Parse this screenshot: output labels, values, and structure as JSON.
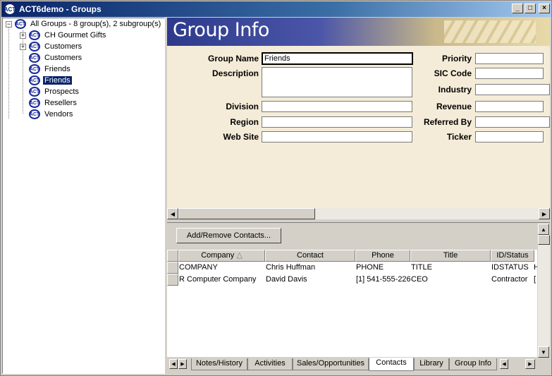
{
  "window": {
    "title": "ACT6demo - Groups",
    "icon": "act-logo-icon"
  },
  "tree": {
    "root": "All Groups - 8 group(s), 2 subgroup(s)",
    "items": [
      {
        "label": "CH Gourmet Gifts",
        "expandable": true
      },
      {
        "label": "Customers",
        "expandable": true
      },
      {
        "label": "Customers",
        "expandable": false
      },
      {
        "label": "Friends",
        "expandable": false
      },
      {
        "label": "Friends",
        "expandable": false,
        "selected": true
      },
      {
        "label": "Prospects",
        "expandable": false
      },
      {
        "label": "Resellers",
        "expandable": false
      },
      {
        "label": "Vendors",
        "expandable": false
      }
    ],
    "expander": "+",
    "root_expander": "−"
  },
  "banner": {
    "title": "Group Info"
  },
  "form": {
    "group_name_label": "Group Name",
    "group_name": "Friends",
    "description_label": "Description",
    "description": "",
    "division_label": "Division",
    "division": "",
    "region_label": "Region",
    "region": "",
    "website_label": "Web Site",
    "website": "",
    "priority_label": "Priority",
    "priority": "",
    "sic_label": "SIC Code",
    "sic": "",
    "industry_label": "Industry",
    "industry": "",
    "revenue_label": "Revenue",
    "revenue": "",
    "referred_label": "Referred By",
    "referred": "",
    "ticker_label": "Ticker",
    "ticker": ""
  },
  "contacts": {
    "add_remove_label": "Add/Remove Contacts...",
    "columns": [
      "Company",
      "Contact",
      "Phone",
      "Title",
      "ID/Status"
    ],
    "sort_indicator": "△",
    "rows": [
      {
        "company": "COMPANY",
        "contact": "Chris Huffman",
        "phone": "PHONE",
        "title": "TITLE",
        "status": "IDSTATUS",
        "extra": "H"
      },
      {
        "company": "R Computer Company",
        "contact": "David Davis",
        "phone": "[1] 541-555-226",
        "title": "CEO",
        "status": "Contractor",
        "extra": "["
      }
    ]
  },
  "tabs": [
    "Notes/History",
    "Activities",
    "Sales/Opportunities",
    "Contacts",
    "Library",
    "Group Info"
  ],
  "active_tab": "Contacts",
  "colors": {
    "title_start": "#0a246a",
    "form_bg": "#f4ecd8",
    "selection": "#0a246a"
  }
}
